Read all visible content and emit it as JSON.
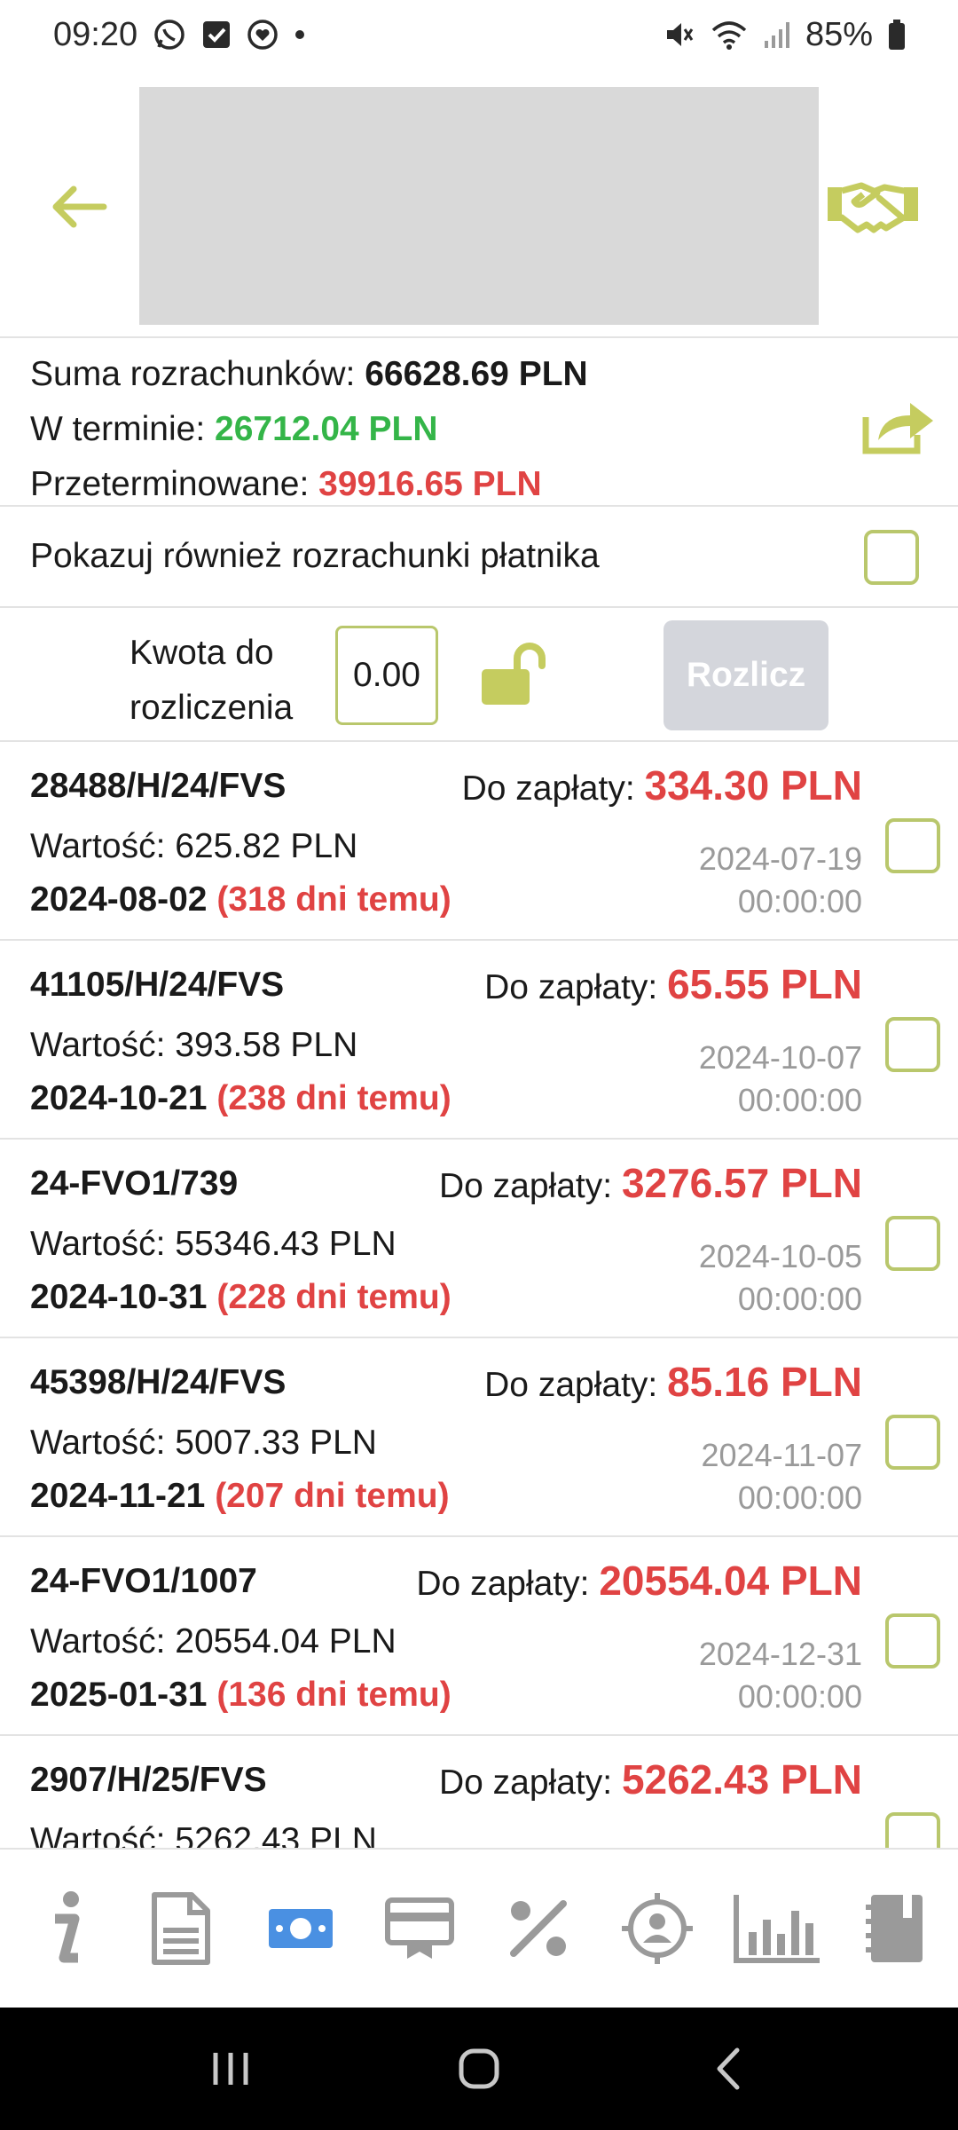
{
  "status_bar": {
    "time": "09:20",
    "battery": "85%"
  },
  "summary": {
    "total_label": "Suma rozrachunków:",
    "total_value": "66628.69 PLN",
    "on_time_label": "W terminie:",
    "on_time_value": "26712.04 PLN",
    "overdue_label": "Przeterminowane:",
    "overdue_value": "39916.65 PLN"
  },
  "option": {
    "label": "Pokazuj również rozrachunki płatnika",
    "checked": false
  },
  "settle": {
    "label_line1": "Kwota do",
    "label_line2": "rozliczenia",
    "amount": "0.00",
    "button": "Rozlicz"
  },
  "list": {
    "due_label": "Do zapłaty:",
    "value_label": "Wartość:",
    "items": [
      {
        "doc": "28488/H/24/FVS",
        "due": "334.30 PLN",
        "value": "625.82 PLN",
        "date": "2024-08-02",
        "late": "(318 dni temu)",
        "ts_date": "2024-07-19",
        "ts_time": "00:00:00"
      },
      {
        "doc": "41105/H/24/FVS",
        "due": "65.55 PLN",
        "value": "393.58 PLN",
        "date": "2024-10-21",
        "late": "(238 dni temu)",
        "ts_date": "2024-10-07",
        "ts_time": "00:00:00"
      },
      {
        "doc": "24-FVO1/739",
        "due": "3276.57 PLN",
        "value": "55346.43 PLN",
        "date": "2024-10-31",
        "late": "(228 dni temu)",
        "ts_date": "2024-10-05",
        "ts_time": "00:00:00"
      },
      {
        "doc": "45398/H/24/FVS",
        "due": "85.16 PLN",
        "value": "5007.33 PLN",
        "date": "2024-11-21",
        "late": "(207 dni temu)",
        "ts_date": "2024-11-07",
        "ts_time": "00:00:00"
      },
      {
        "doc": "24-FVO1/1007",
        "due": "20554.04 PLN",
        "value": "20554.04 PLN",
        "date": "2025-01-31",
        "late": "(136 dni temu)",
        "ts_date": "2024-12-31",
        "ts_time": "00:00:00"
      },
      {
        "doc": "2907/H/25/FVS",
        "due": "5262.43 PLN",
        "value": "5262.43 PLN",
        "date": "",
        "late": "",
        "ts_date": "",
        "ts_time": ""
      }
    ]
  },
  "colors": {
    "accent": "#b9c76c",
    "red": "#e04343",
    "green": "#34b548",
    "active_tab": "#4a90e2"
  },
  "bottom_nav": [
    "info-icon",
    "document-icon",
    "money-icon",
    "card-icon",
    "percent-icon",
    "contact-target-icon",
    "bar-chart-icon",
    "notebook-icon"
  ]
}
